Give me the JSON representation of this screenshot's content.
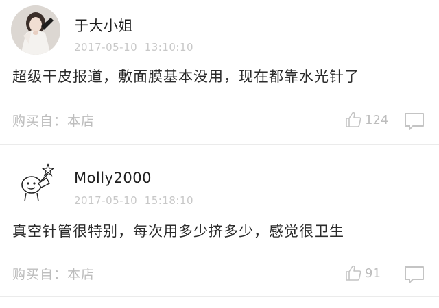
{
  "reviews": [
    {
      "username": "于大小姐",
      "timestamp": "2017-05-10  13:10:10",
      "content": "超级干皮报道，敷面膜基本没用，现在都靠水光针了",
      "source": "购买自：本店",
      "likes": "124",
      "avatar_icon": "woman-photo-avatar"
    },
    {
      "username": "Molly2000",
      "timestamp": "2017-05-10  15:18:10",
      "content": "真空针管很特别，每次用多少挤多少，感觉很卫生",
      "source": "购买自：本店",
      "likes": "91",
      "avatar_icon": "cartoon-doodle-avatar"
    }
  ],
  "icons": {
    "like": "thumbs-up-icon",
    "comment": "comment-icon"
  },
  "colors": {
    "text": "#2b2b2b",
    "muted": "#bdbdbd",
    "timestamp": "#c8c8c8",
    "divider": "#ebebeb"
  }
}
